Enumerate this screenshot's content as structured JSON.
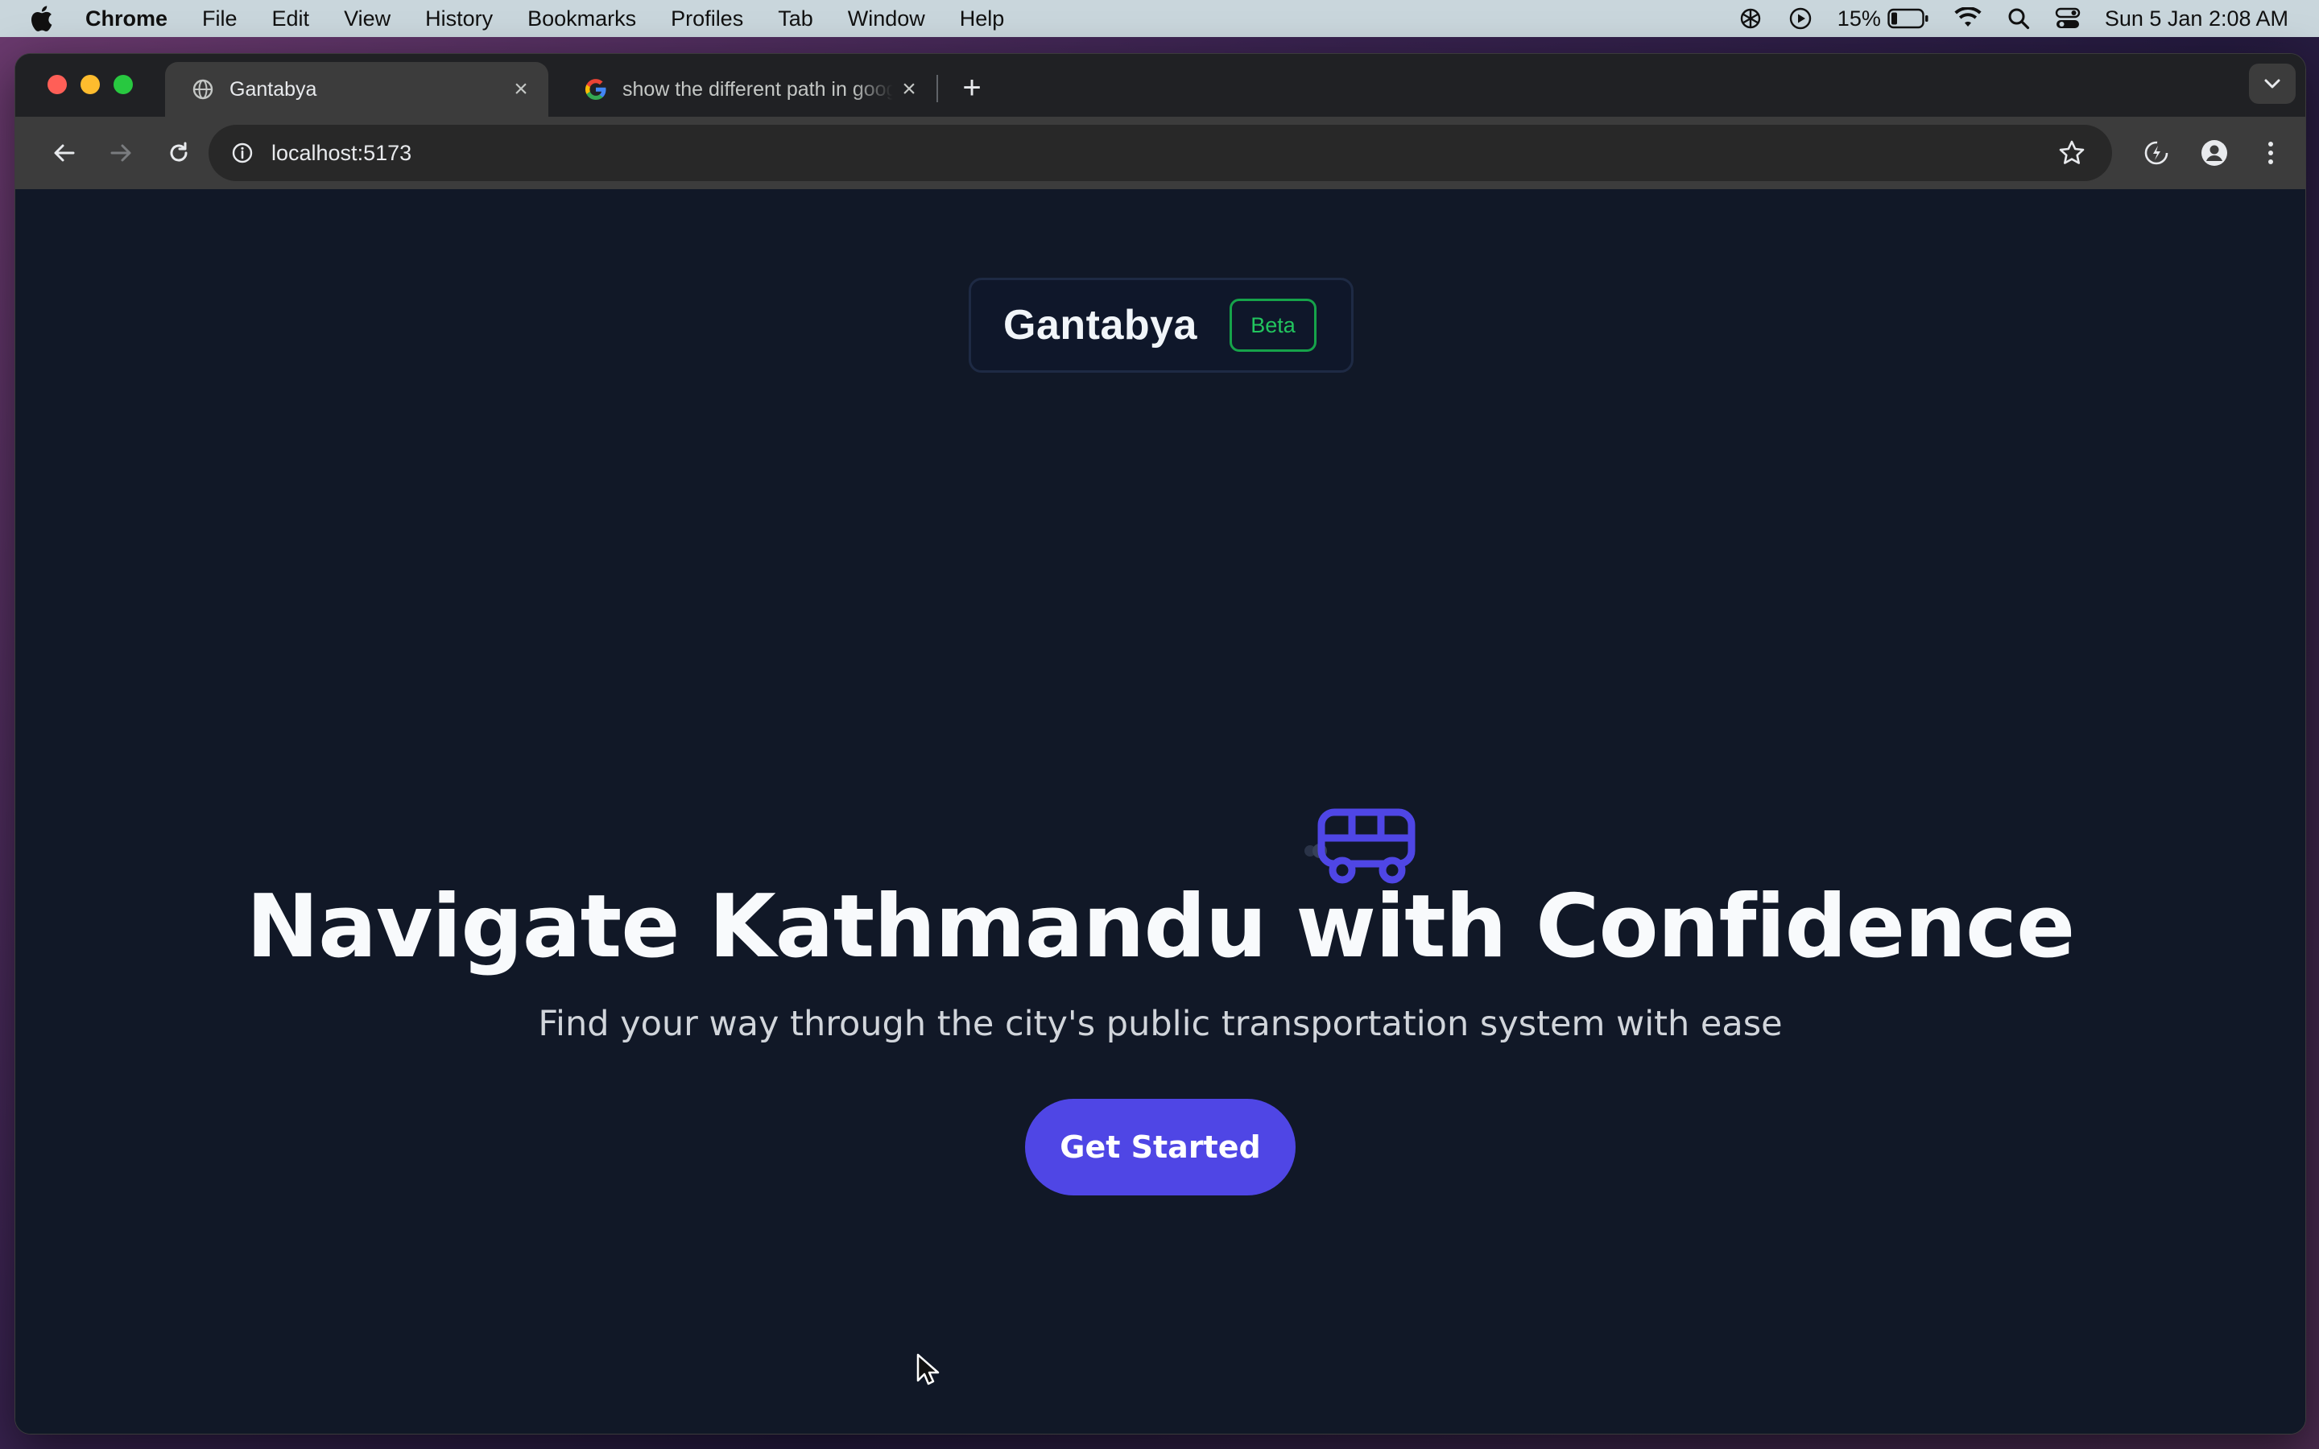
{
  "menubar": {
    "app_name": "Chrome",
    "items": [
      "File",
      "Edit",
      "View",
      "History",
      "Bookmarks",
      "Profiles",
      "Tab",
      "Window",
      "Help"
    ],
    "battery_percent": "15%",
    "datetime": "Sun 5 Jan  2:08 AM"
  },
  "browser": {
    "tabs": [
      {
        "title": "Gantabya",
        "favicon": "globe-icon",
        "active": true
      },
      {
        "title": "show the different path in google",
        "favicon": "google-icon",
        "active": false
      }
    ],
    "url": "localhost:5173"
  },
  "page": {
    "brand_name": "Gantabya",
    "badge": "Beta",
    "headline": "Navigate Kathmandu with Confidence",
    "subheadline": "Find your way through the city's public transportation system with ease",
    "cta_label": "Get Started"
  },
  "colors": {
    "page_bg": "#111827",
    "accent": "#4f46e5",
    "beta_green": "#22c55e",
    "bus_icon": "#4f46e5"
  }
}
